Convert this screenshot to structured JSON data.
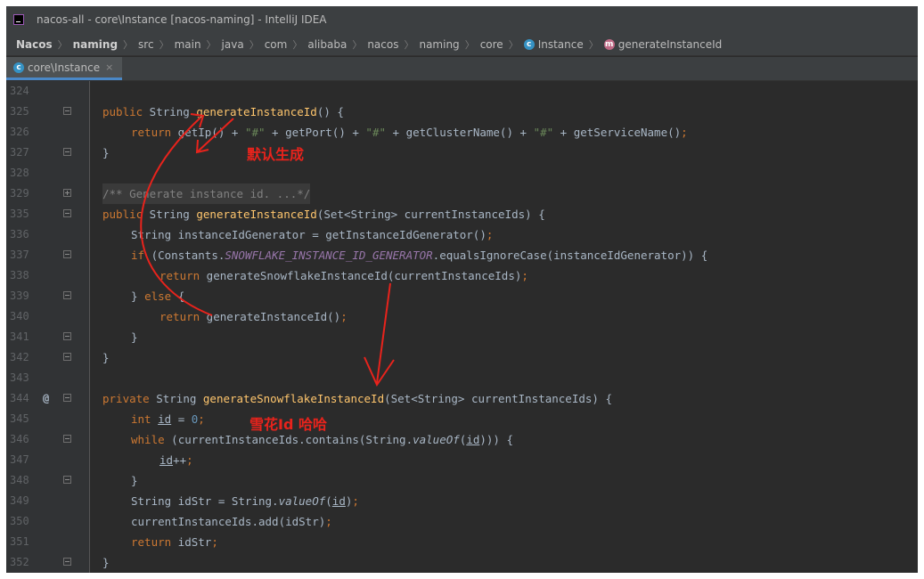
{
  "window": {
    "title": "nacos-all - core\\Instance [nacos-naming] - IntelliJ IDEA"
  },
  "breadcrumbs": [
    {
      "label": "Nacos",
      "bold": true
    },
    {
      "label": "naming",
      "bold": true
    },
    {
      "label": "src"
    },
    {
      "label": "main"
    },
    {
      "label": "java"
    },
    {
      "label": "com"
    },
    {
      "label": "alibaba"
    },
    {
      "label": "nacos"
    },
    {
      "label": "naming"
    },
    {
      "label": "core"
    },
    {
      "label": "Instance",
      "icon": "class-icon"
    },
    {
      "label": "generateInstanceId",
      "icon": "method-icon"
    }
  ],
  "tab": {
    "label": "core\\Instance",
    "close": "×"
  },
  "code_lines": [
    {
      "num": "324",
      "fold": "",
      "ann": ""
    },
    {
      "num": "325",
      "fold": "minus",
      "ann": ""
    },
    {
      "num": "326",
      "fold": "",
      "ann": ""
    },
    {
      "num": "327",
      "fold": "minus",
      "ann": ""
    },
    {
      "num": "328",
      "fold": "",
      "ann": ""
    },
    {
      "num": "329",
      "fold": "plus",
      "ann": ""
    },
    {
      "num": "335",
      "fold": "minus",
      "ann": ""
    },
    {
      "num": "336",
      "fold": "",
      "ann": ""
    },
    {
      "num": "337",
      "fold": "minus",
      "ann": ""
    },
    {
      "num": "338",
      "fold": "",
      "ann": ""
    },
    {
      "num": "339",
      "fold": "minus",
      "ann": ""
    },
    {
      "num": "340",
      "fold": "",
      "ann": ""
    },
    {
      "num": "341",
      "fold": "minus",
      "ann": ""
    },
    {
      "num": "342",
      "fold": "minus",
      "ann": ""
    },
    {
      "num": "343",
      "fold": "",
      "ann": ""
    },
    {
      "num": "344",
      "fold": "minus",
      "ann": "@"
    },
    {
      "num": "345",
      "fold": "",
      "ann": ""
    },
    {
      "num": "346",
      "fold": "minus",
      "ann": ""
    },
    {
      "num": "347",
      "fold": "",
      "ann": ""
    },
    {
      "num": "348",
      "fold": "minus",
      "ann": ""
    },
    {
      "num": "349",
      "fold": "",
      "ann": ""
    },
    {
      "num": "350",
      "fold": "",
      "ann": ""
    },
    {
      "num": "351",
      "fold": "",
      "ann": ""
    },
    {
      "num": "352",
      "fold": "minus",
      "ann": ""
    }
  ],
  "code_text": {
    "l325": [
      "public",
      " String ",
      "generateInstanceId",
      "() {"
    ],
    "l326": [
      "return",
      " getIp() + ",
      "\"#\"",
      " + getPort() + ",
      "\"#\"",
      " + getClusterName() + ",
      "\"#\"",
      " + getServiceName()",
      ";"
    ],
    "l327": [
      "}"
    ],
    "l329": [
      "/** Generate instance id. ...*/"
    ],
    "l335": [
      "public",
      " String ",
      "generateInstanceId",
      "(Set<String> currentInstanceIds) {"
    ],
    "l336": [
      "String instanceIdGenerator = getInstanceIdGenerator()",
      ";"
    ],
    "l337": [
      "if",
      " (Constants.",
      "SNOWFLAKE_INSTANCE_ID_GENERATOR",
      ".equalsIgnoreCase(instanceIdGenerator)) {"
    ],
    "l338": [
      "return",
      " generateSnowflakeInstanceId(currentInstanceIds)",
      ";"
    ],
    "l339": [
      "} ",
      "else",
      " {"
    ],
    "l340": [
      "return",
      " generateInstanceId()",
      ";"
    ],
    "l341": [
      "}"
    ],
    "l342": [
      "}"
    ],
    "l344": [
      "private",
      " String ",
      "generateSnowflakeInstanceId",
      "(Set<String> currentInstanceIds) {"
    ],
    "l345": [
      "int",
      " ",
      "id",
      " = ",
      "0",
      ";"
    ],
    "l346": [
      "while",
      " (currentInstanceIds.contains(String.",
      "valueOf",
      "(",
      "id",
      "))) {"
    ],
    "l347": [
      "id",
      "++",
      ";"
    ],
    "l348": [
      "}"
    ],
    "l349": [
      "String idStr = String.",
      "valueOf",
      "(",
      "id",
      ")",
      ";"
    ],
    "l350": [
      "currentInstanceIds.add(idStr)",
      ";"
    ],
    "l351": [
      "return",
      " idStr",
      ";"
    ],
    "l352": [
      "}"
    ]
  },
  "annotations": {
    "default_generate": "默认生成",
    "snowflake_id": "雪花Id 哈哈"
  },
  "colors": {
    "keyword": "#cc7832",
    "method": "#ffc66d",
    "string": "#6a8759",
    "number": "#6897bb",
    "comment": "#808080",
    "constant": "#9876aa",
    "annotation_red": "#e8231c"
  }
}
